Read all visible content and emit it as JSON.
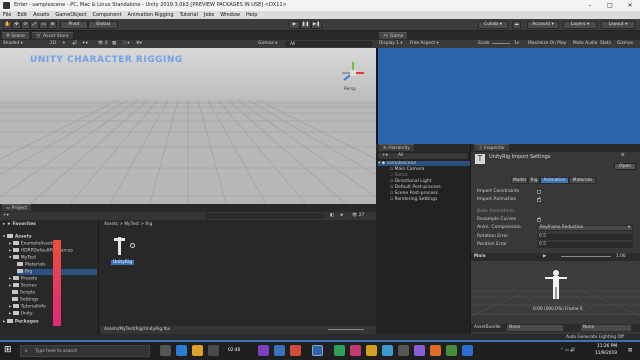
{
  "window": {
    "title": "Enter - samplescene - PC, Mac & Linux Standalone - Unity 2019.3.0b3 [PREVIEW PACKAGES IN USE] <DX11>"
  },
  "menu": [
    "File",
    "Edit",
    "Assets",
    "GameObject",
    "Component",
    "Animation Rigging",
    "Tutorial",
    "Jobs",
    "Window",
    "Help"
  ],
  "toolbar": {
    "pivot": "Pivot",
    "global": "Global",
    "collab": "Collab",
    "account": "Account",
    "layers": "Layers",
    "layout": "Layout"
  },
  "scene_panel": {
    "tabs": [
      "Scene",
      "Asset Store"
    ],
    "shading": "Shaded",
    "mode_2d": "2D",
    "gizmos": "Gizmos",
    "search_all": "All",
    "persp": "Persp",
    "overlay_text": "UNITY CHARACTER RIGGING"
  },
  "game_panel": {
    "tab": "Game",
    "display": "Display 1",
    "aspect": "Free Aspect",
    "scale_label": "Scale",
    "scale_value": "1x",
    "maximize": "Maximize On Play",
    "mute": "Mute Audio",
    "stats": "Stats",
    "gizmos": "Gizmos"
  },
  "hierarchy": {
    "tab": "Hierarchy",
    "search_all": "All",
    "scene": "samplescene",
    "items": [
      "Main Camera",
      "Robot",
      "Directional Light",
      "Default Post-process",
      "Scene Post-process",
      "Rendering Settings"
    ]
  },
  "inspector": {
    "tab": "Inspector",
    "title": "UnityRig Import Settings",
    "open": "Open",
    "tabs": [
      "Model",
      "Rig",
      "Animation",
      "Materials"
    ],
    "rows": [
      {
        "label": "Import Constraints",
        "checked": false
      },
      {
        "label": "Import Animation",
        "checked": true
      }
    ],
    "section": "Bake Animations",
    "resample": "Resample Curves",
    "compression_label": "Anim. Compression",
    "compression_value": "Keyframe Reduction",
    "rotation_label": "Rotation Error",
    "rotation_value": "0.5",
    "position_label": "Position Error",
    "position_value": "0.5",
    "preview_title": "Main",
    "preview_time": "0:00 (000.0%) Frame 0",
    "asset_bundle_label": "AssetBundle",
    "asset_bundle_value": "None",
    "asset_bundle_variant": "None"
  },
  "project": {
    "tab": "Project",
    "favorites": "Favorites",
    "assets_root": "Assets",
    "tree": [
      "ExampleAssets",
      "HDRPDefaultResources",
      "MyTest",
      "Materials",
      "Rig",
      "Presets",
      "Scenes",
      "Scripts",
      "Settings",
      "TutorialInfo",
      "Unity"
    ],
    "packages": "Packages",
    "breadcrumb": [
      "Assets",
      "MyTest",
      "Rig"
    ],
    "asset_name": "UnityRig",
    "footer_path": "Assets/MyTest/Rig/UnityRig.fbx",
    "count": "27"
  },
  "status": {
    "right": "Auto Generate Lighting Off"
  },
  "taskbar": {
    "search_placeholder": "Type here to search",
    "time": "11:26 PM",
    "date": "11/9/2019",
    "media_time": "02:46"
  },
  "colors": {
    "game_bg": "#2d62ad",
    "accent_blue": "#3a72b8",
    "gradient_top": "#e8503c",
    "gradient_bottom": "#e0287a"
  }
}
